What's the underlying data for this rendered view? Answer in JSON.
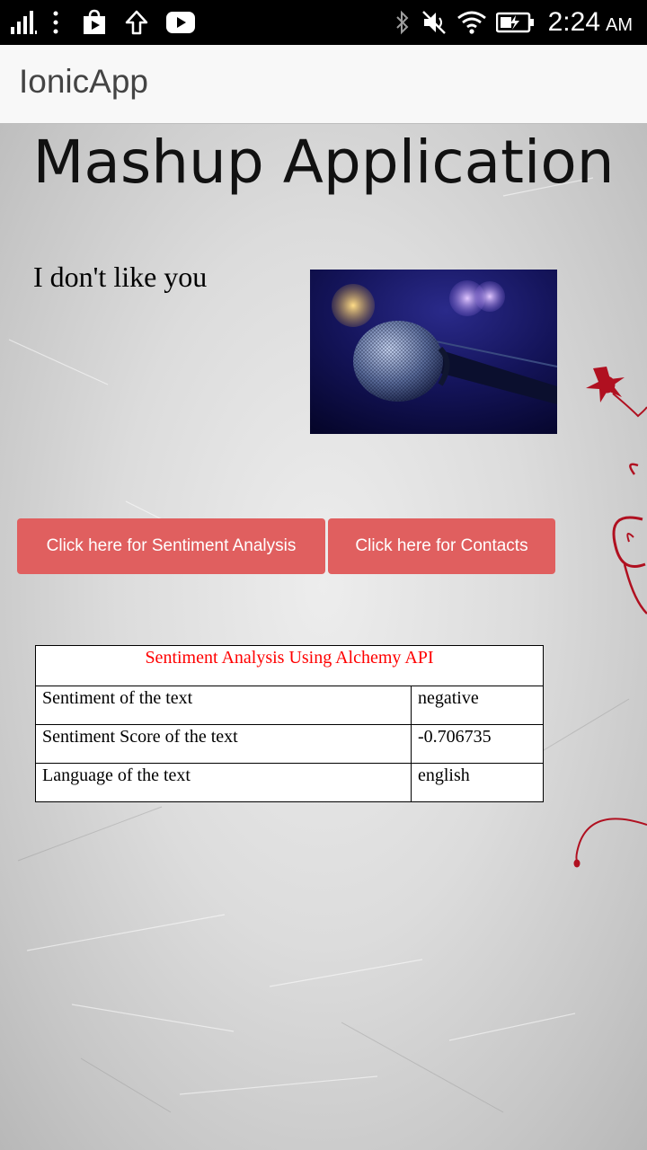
{
  "status_bar": {
    "time": "2:24",
    "ampm": "AM",
    "icons": [
      "signal-icon",
      "more-vert-icon",
      "play-store-icon",
      "upload-icon",
      "youtube-icon",
      "bluetooth-icon",
      "mute-icon",
      "wifi-icon",
      "battery-icon"
    ]
  },
  "header": {
    "title": "IonicApp"
  },
  "page": {
    "title": "Mashup Application",
    "quote": "I don't like you"
  },
  "buttons": {
    "sentiment": "Click here for Sentiment Analysis",
    "contacts": "Click here for Contacts"
  },
  "table": {
    "caption": "Sentiment Analysis Using Alchemy API",
    "rows": [
      {
        "label": "Sentiment of the text",
        "value": "negative"
      },
      {
        "label": "Sentiment Score of the text",
        "value": "-0.706735"
      },
      {
        "label": "Language of the text",
        "value": "english"
      }
    ]
  },
  "colors": {
    "button": "#e05f5f",
    "caption": "#ff0000",
    "header_bg": "#f8f8f8"
  }
}
